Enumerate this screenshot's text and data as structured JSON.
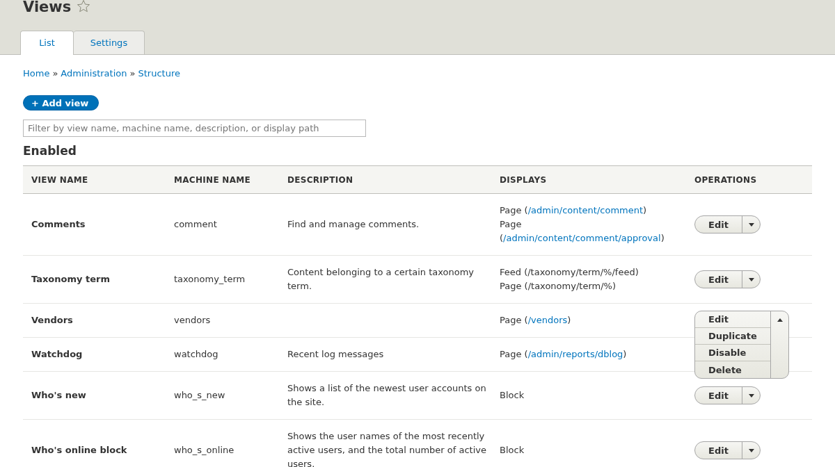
{
  "page_title": "Views",
  "tabs": [
    {
      "label": "List",
      "selected": true
    },
    {
      "label": "Settings",
      "selected": false
    }
  ],
  "breadcrumb": [
    {
      "label": "Home"
    },
    {
      "label": "Administration"
    },
    {
      "label": "Structure"
    }
  ],
  "breadcrumb_separator": "»",
  "add_button": "+ Add view",
  "filter": {
    "placeholder": "Filter by view name, machine name, description, or display path"
  },
  "section_title": "Enabled",
  "table": {
    "columns": [
      "VIEW NAME",
      "MACHINE NAME",
      "DESCRIPTION",
      "DISPLAYS",
      "OPERATIONS"
    ],
    "rows": [
      {
        "name": "Comments",
        "machine": "comment",
        "description": "Find and manage comments.",
        "displays": [
          {
            "kind": "link",
            "before": "Page (",
            "path": "/admin/content/comment",
            "after": ")"
          },
          {
            "kind": "link",
            "before": "Page (",
            "path": "/admin/content/comment/approval",
            "after": ")"
          }
        ],
        "operations": {
          "expanded": false,
          "actions": [
            "Edit"
          ]
        }
      },
      {
        "name": "Taxonomy term",
        "machine": "taxonomy_term",
        "description": "Content belonging to a certain taxonomy term.",
        "displays": [
          {
            "kind": "plain",
            "text": "Feed (/taxonomy/term/%/feed)"
          },
          {
            "kind": "plain",
            "text": "Page (/taxonomy/term/%)"
          }
        ],
        "operations": {
          "expanded": false,
          "actions": [
            "Edit"
          ]
        }
      },
      {
        "name": "Vendors",
        "machine": "vendors",
        "description": "",
        "displays": [
          {
            "kind": "link",
            "before": "Page (",
            "path": "/vendors",
            "after": ")"
          }
        ],
        "operations": {
          "expanded": true,
          "actions": [
            "Edit",
            "Duplicate",
            "Disable",
            "Delete"
          ]
        }
      },
      {
        "name": "Watchdog",
        "machine": "watchdog",
        "description": "Recent log messages",
        "displays": [
          {
            "kind": "link",
            "before": "Page (",
            "path": "/admin/reports/dblog",
            "after": ")"
          }
        ]
      },
      {
        "name": "Who's new",
        "machine": "who_s_new",
        "description": "Shows a list of the newest user accounts on the site.",
        "displays": [
          {
            "kind": "plain",
            "text": "Block"
          }
        ],
        "operations": {
          "expanded": false,
          "actions": [
            "Edit"
          ]
        }
      },
      {
        "name": "Who's online block",
        "machine": "who_s_online",
        "description": "Shows the user names of the most recently active users, and the total number of active users.",
        "displays": [
          {
            "kind": "plain",
            "text": "Block"
          }
        ],
        "operations": {
          "expanded": false,
          "actions": [
            "Edit"
          ]
        }
      }
    ]
  }
}
